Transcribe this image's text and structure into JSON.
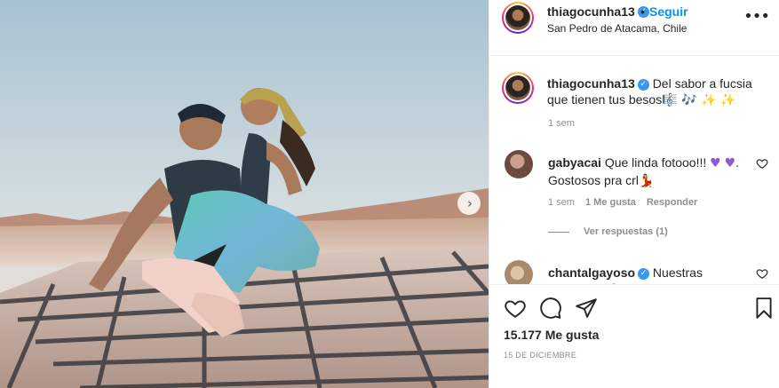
{
  "post": {
    "username": "thiago‌cunha13",
    "follow_label": "Seguir",
    "separator": "•",
    "location": "San Pedro de Atacama, Chile",
    "more_label": "•••"
  },
  "caption": {
    "username": "thiagocunha13",
    "text": "Del sabor a fucsia que tienen tus besos",
    "emojis": "🎼 🎶 ✨ ✨",
    "time": "1 sem"
  },
  "comments": [
    {
      "username": "gabyacai",
      "text": "Que linda fotooo!!!",
      "heart1": "♥",
      "text2": ". Gostosos pra crl",
      "heart2": "♥",
      "emoji_end": "💃",
      "time": "1 sem",
      "likes": "1 Me gusta",
      "reply": "Responder",
      "view_replies": "Ver respuestas (1)"
    },
    {
      "username": "chantalgayoso",
      "text": "Nuestras canciones",
      "tail": "😊 ?"
    }
  ],
  "footer": {
    "likes": "15.177 Me gusta",
    "date": "15 DE DICIEMBRE"
  },
  "icons": {
    "verified": "✓",
    "next": "›"
  },
  "colors": {
    "link": "#0095f6",
    "verified": "#3897f0",
    "muted": "#8e8e8e"
  }
}
